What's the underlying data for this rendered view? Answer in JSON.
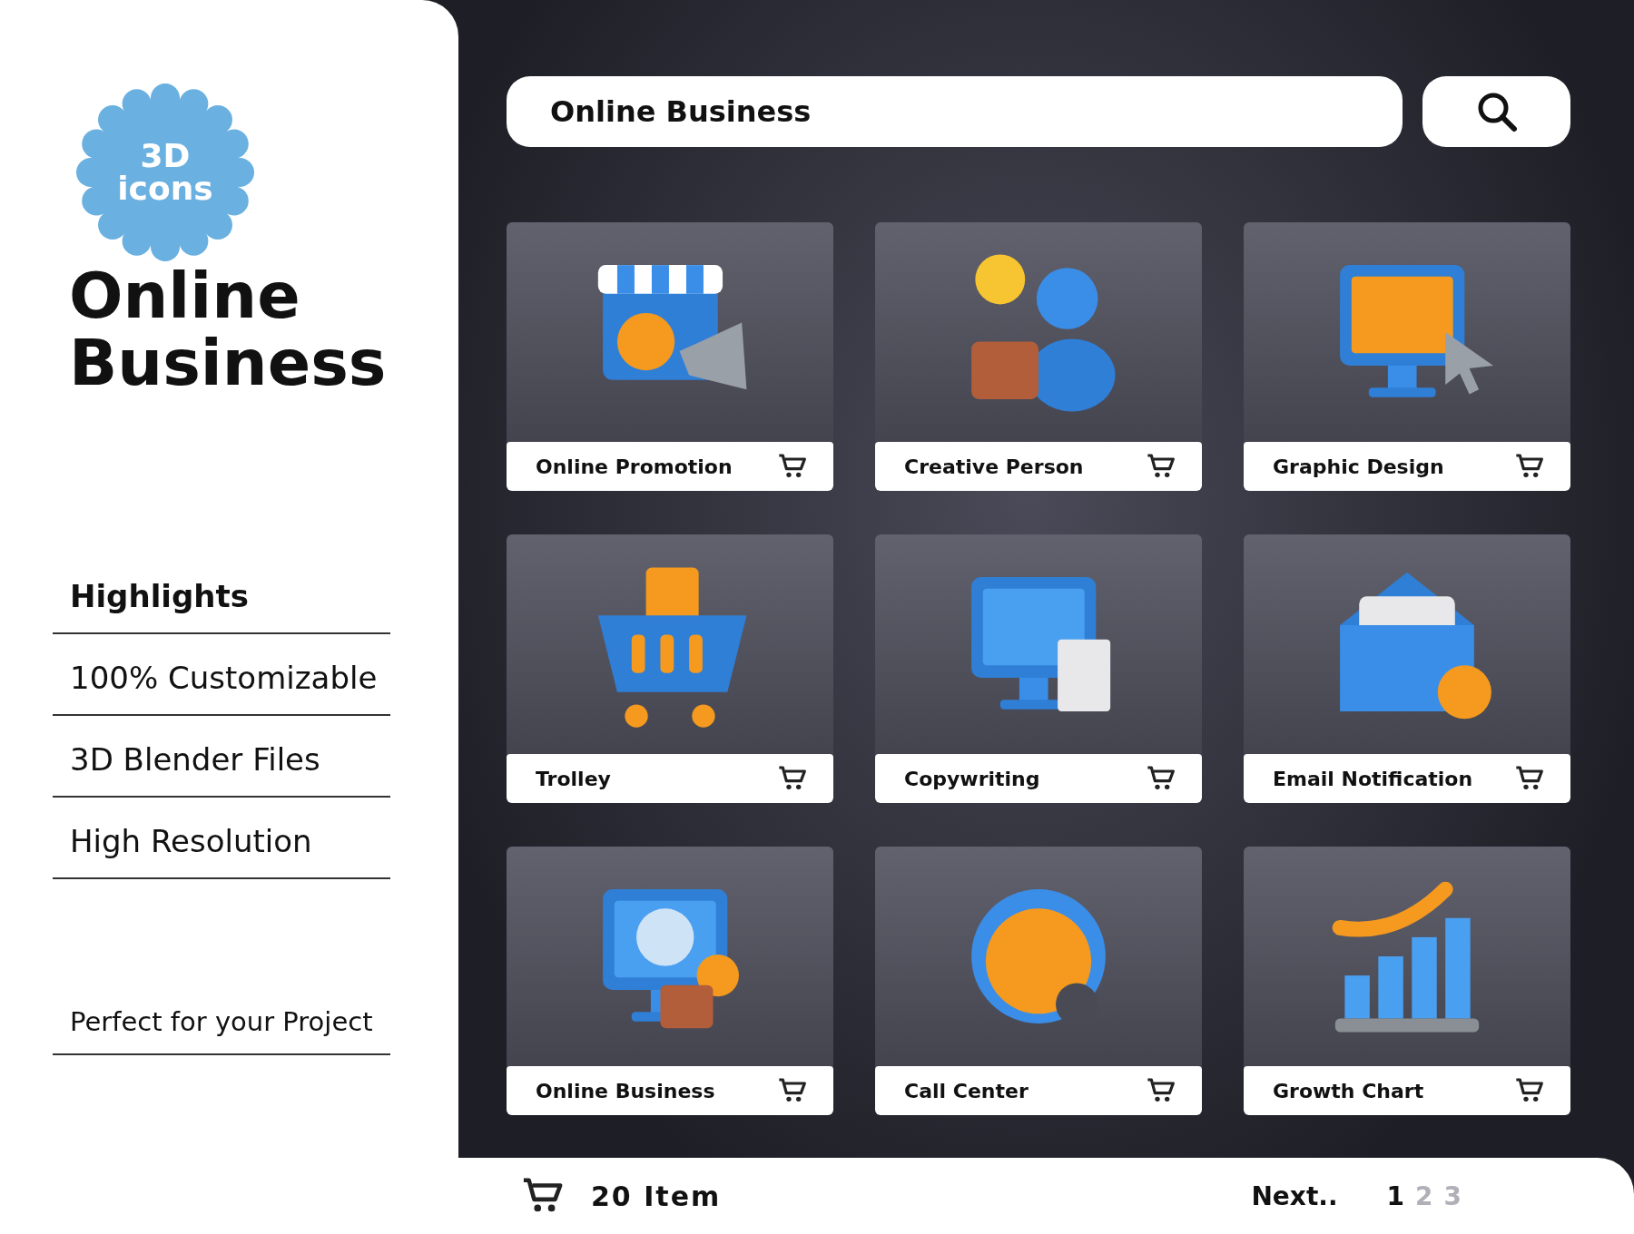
{
  "badge": {
    "lines": [
      "3D",
      "icons"
    ]
  },
  "title": [
    "Online",
    "Business"
  ],
  "highlights": {
    "heading": "Highlights",
    "items": [
      "100% Customizable",
      "3D Blender Files",
      "High Resolution"
    ]
  },
  "tagline": "Perfect for your Project",
  "search": {
    "value": "Online Business"
  },
  "cards": [
    {
      "label": "Online Promotion"
    },
    {
      "label": "Creative Person"
    },
    {
      "label": "Graphic Design"
    },
    {
      "label": "Trolley"
    },
    {
      "label": "Copywriting"
    },
    {
      "label": "Email Notification"
    },
    {
      "label": "Online Business"
    },
    {
      "label": "Call Center"
    },
    {
      "label": "Growth Chart"
    }
  ],
  "footer": {
    "count": "20 Item",
    "next": "Next..",
    "pages": [
      {
        "label": "1",
        "selected": true
      },
      {
        "label": "2",
        "selected": false
      },
      {
        "label": "3",
        "selected": false
      }
    ]
  }
}
